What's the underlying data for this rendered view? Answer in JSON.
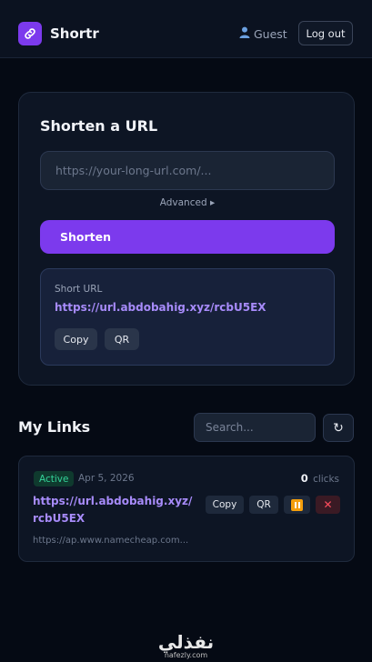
{
  "header": {
    "brand": "Shortr",
    "user_label": "Guest",
    "logout_label": "Log out"
  },
  "shorten": {
    "title": "Shorten a URL",
    "url_placeholder": "https://your-long-url.com/...",
    "advanced_label": "Advanced ▸",
    "submit_label": "Shorten",
    "result": {
      "label": "Short URL",
      "url": "https://url.abdobahig.xyz/rcbU5EX",
      "copy_label": "Copy",
      "qr_label": "QR"
    }
  },
  "links": {
    "title": "My Links",
    "search_placeholder": "Search...",
    "refresh_icon": "↻",
    "items": [
      {
        "status": "Active",
        "date": "Apr 5, 2026",
        "clicks": "0",
        "clicks_label": "clicks",
        "short_url": "https://url.abdobahig.xyz/rcbU5EX",
        "original_url": "https://ap.www.namecheap.com...",
        "copy_label": "Copy",
        "qr_label": "QR",
        "delete_icon": "✕"
      }
    ]
  },
  "footer": {
    "brand_arabic": "نفذلي",
    "brand_latin": "nafezly.com"
  },
  "colors": {
    "accent": "#7c3aed",
    "link": "#a78bfa",
    "active": "#34d399",
    "danger": "#ff4d5e",
    "pause": "#f59e0b"
  }
}
